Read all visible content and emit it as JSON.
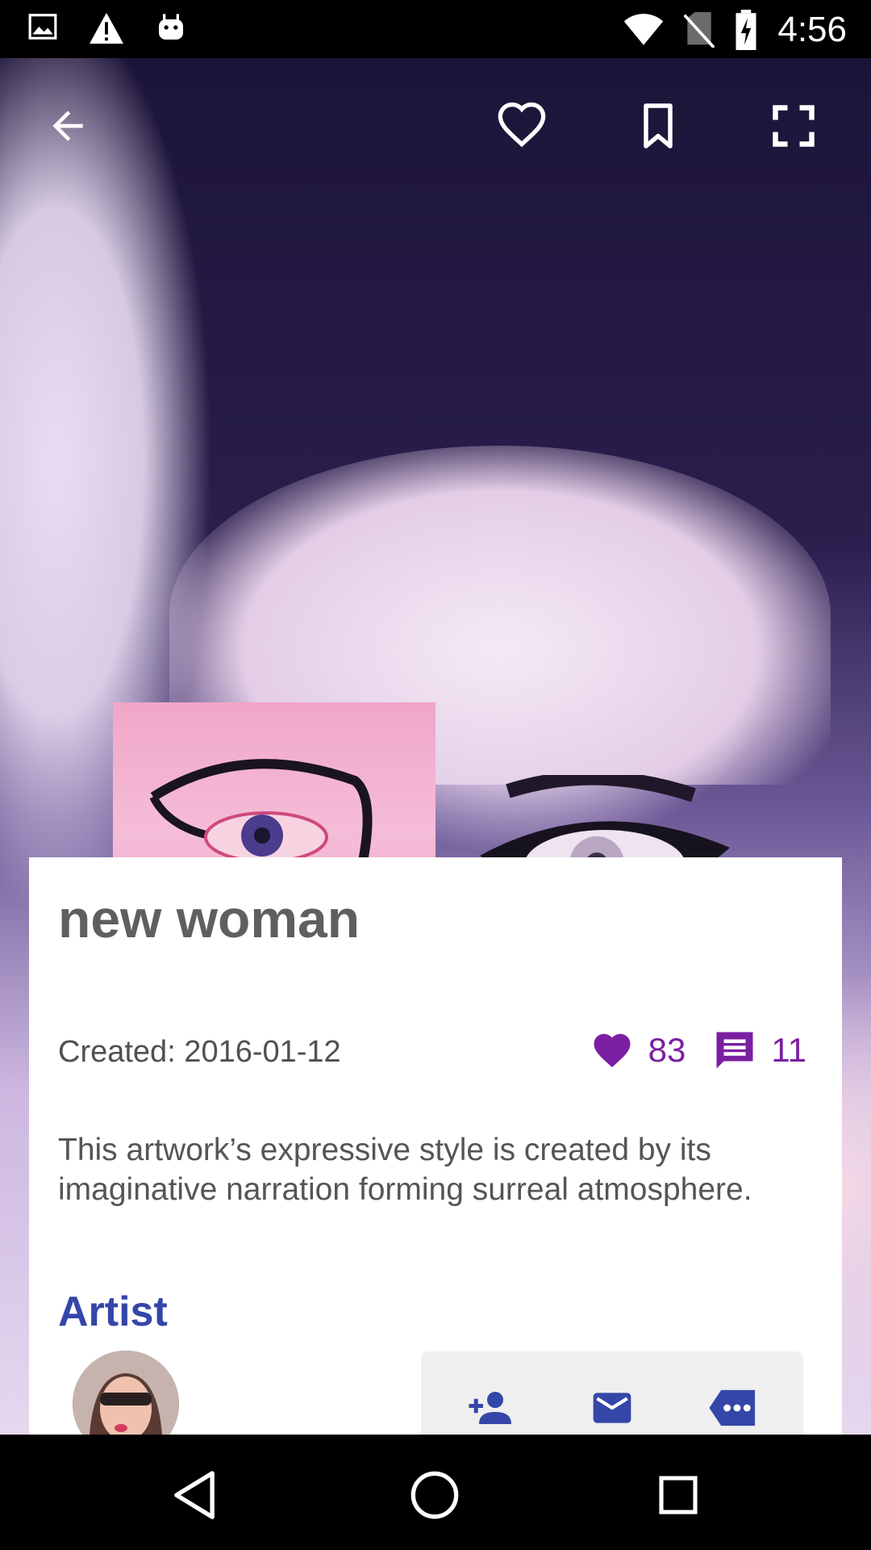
{
  "status_bar": {
    "time": "4:56",
    "icons_left": [
      "image-icon",
      "warning-icon",
      "android-icon"
    ],
    "icons_right": [
      "wifi-icon",
      "no-sim-icon",
      "battery-charging-icon"
    ]
  },
  "toolbar": {
    "back_icon": "arrow-back-icon",
    "actions": [
      "heart-outline-icon",
      "bookmark-outline-icon",
      "fullscreen-icon"
    ]
  },
  "artwork": {
    "title": "new woman",
    "created": "Created: 2016-01-12",
    "likes": "83",
    "comments": "11",
    "description": "This artwork’s expressive style is created by its imaginative narration forming surreal atmosphere."
  },
  "artist": {
    "heading": "Artist",
    "actions": [
      "add-person-icon",
      "mail-icon",
      "more-message-icon"
    ]
  },
  "colors": {
    "accent_purple": "#7b1fa2",
    "heading_blue": "#3446a8",
    "title_gray": "#5f5f5f"
  },
  "nav_bar": {
    "buttons": [
      "back-triangle-icon",
      "home-circle-icon",
      "recents-square-icon"
    ]
  }
}
